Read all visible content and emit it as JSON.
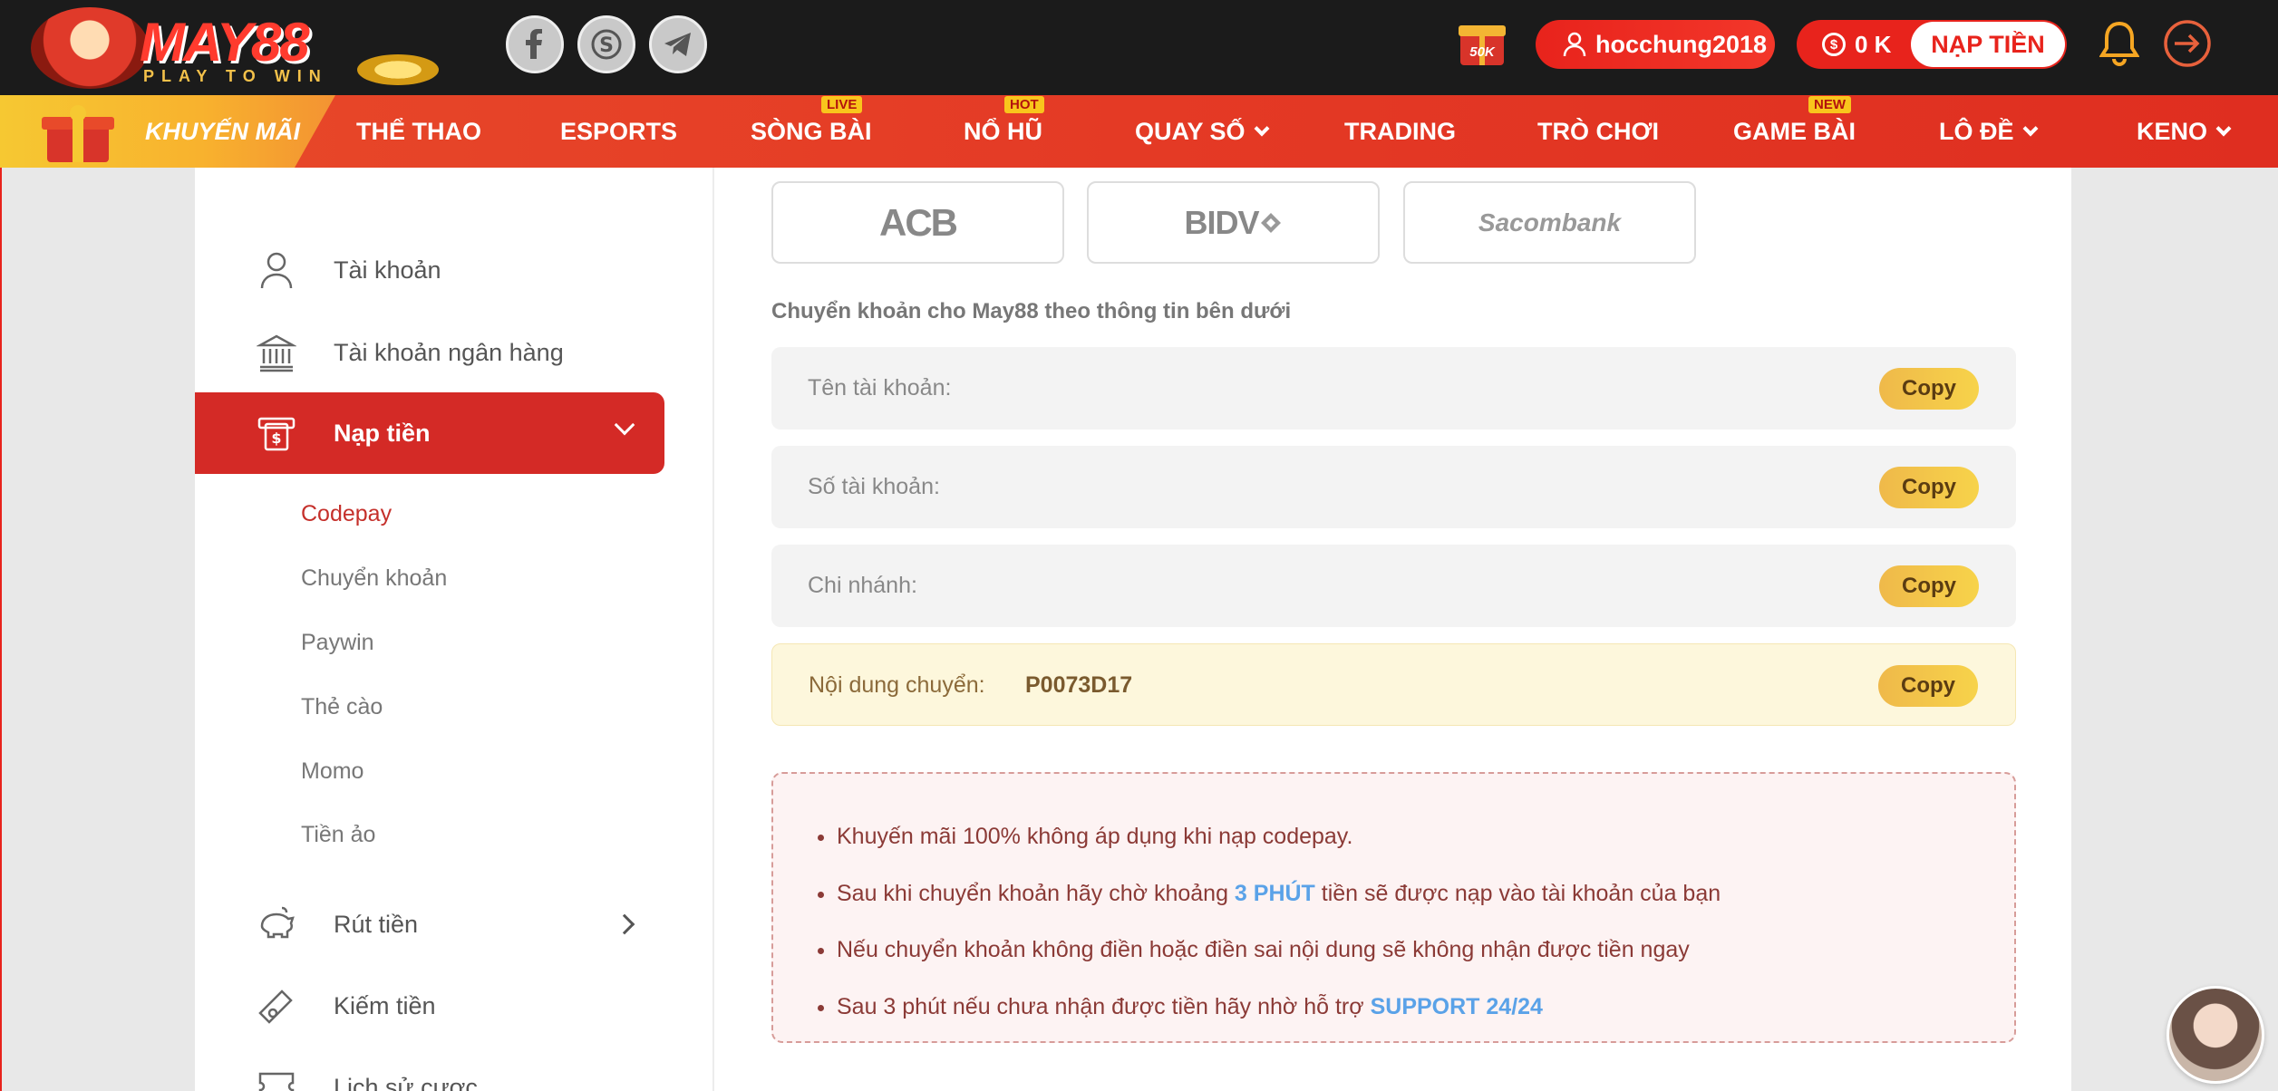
{
  "header": {
    "logo_text": "MAY88",
    "logo_tagline": "PLAY TO WIN",
    "social": [
      "facebook-icon",
      "skype-icon",
      "telegram-icon"
    ],
    "promo_badge": "50K",
    "username": "hocchung2018",
    "balance": "0 K",
    "deposit_button": "NẠP TIỀN"
  },
  "nav": {
    "promo": "KHUYẾN MÃI",
    "items": [
      {
        "label": "THỂ THAO"
      },
      {
        "label": "ESPORTS"
      },
      {
        "label": "SÒNG BÀI",
        "badge": "LIVE"
      },
      {
        "label": "NỔ HŨ",
        "badge": "HOT"
      },
      {
        "label": "QUAY SỐ",
        "dropdown": true
      },
      {
        "label": "TRADING"
      },
      {
        "label": "TRÒ CHƠI"
      },
      {
        "label": "GAME BÀI",
        "badge": "NEW"
      },
      {
        "label": "LÔ ĐỀ",
        "dropdown": true
      },
      {
        "label": "KENO",
        "dropdown": true
      }
    ]
  },
  "sidebar": {
    "items": [
      {
        "label": "Tài khoản",
        "icon": "user-icon"
      },
      {
        "label": "Tài khoản ngân hàng",
        "icon": "bank-icon"
      },
      {
        "label": "Nạp tiền",
        "icon": "deposit-icon",
        "active": true
      },
      {
        "label": "Rút tiền",
        "icon": "piggy-bank-icon"
      },
      {
        "label": "Kiếm tiền",
        "icon": "ticket-icon"
      },
      {
        "label": "Lịch sử cược",
        "icon": "history-icon"
      }
    ],
    "sub_items": [
      "Codepay",
      "Chuyển khoản",
      "Paywin",
      "Thẻ cào",
      "Momo",
      "Tiền ảo"
    ],
    "active_sub": "Codepay"
  },
  "main": {
    "banks": [
      "ACB",
      "BIDV",
      "Sacombank"
    ],
    "instruction": "Chuyển khoản cho May88 theo thông tin bên dưới",
    "rows": [
      {
        "label": "Tên tài khoản:",
        "value": "",
        "button": "Copy"
      },
      {
        "label": "Số tài khoản:",
        "value": "",
        "button": "Copy"
      },
      {
        "label": "Chi nhánh:",
        "value": "",
        "button": "Copy"
      },
      {
        "label": "Nội dung chuyển:",
        "value": "P0073D17",
        "button": "Copy"
      }
    ],
    "notes": {
      "n1": "Khuyến mãi 100% không áp dụng khi nạp codepay.",
      "n2_pre": "Sau khi chuyển khoản hãy chờ khoảng ",
      "n2_hl": "3 PHÚT",
      "n2_post": " tiền sẽ được nạp vào tài khoản của bạn",
      "n3": "Nếu chuyển khoản không điền hoặc điền sai nội dung sẽ không nhận được tiền ngay",
      "n4_pre": "Sau 3 phút nếu chưa nhận được tiền hãy nhờ hỗ trợ ",
      "n4_hl": "SUPPORT 24/24"
    }
  },
  "colors": {
    "brand_red": "#e8231c",
    "active_sidebar": "#d42a26",
    "copy_button": "#f2c34a",
    "highlight_blue": "#5aa2e8"
  }
}
